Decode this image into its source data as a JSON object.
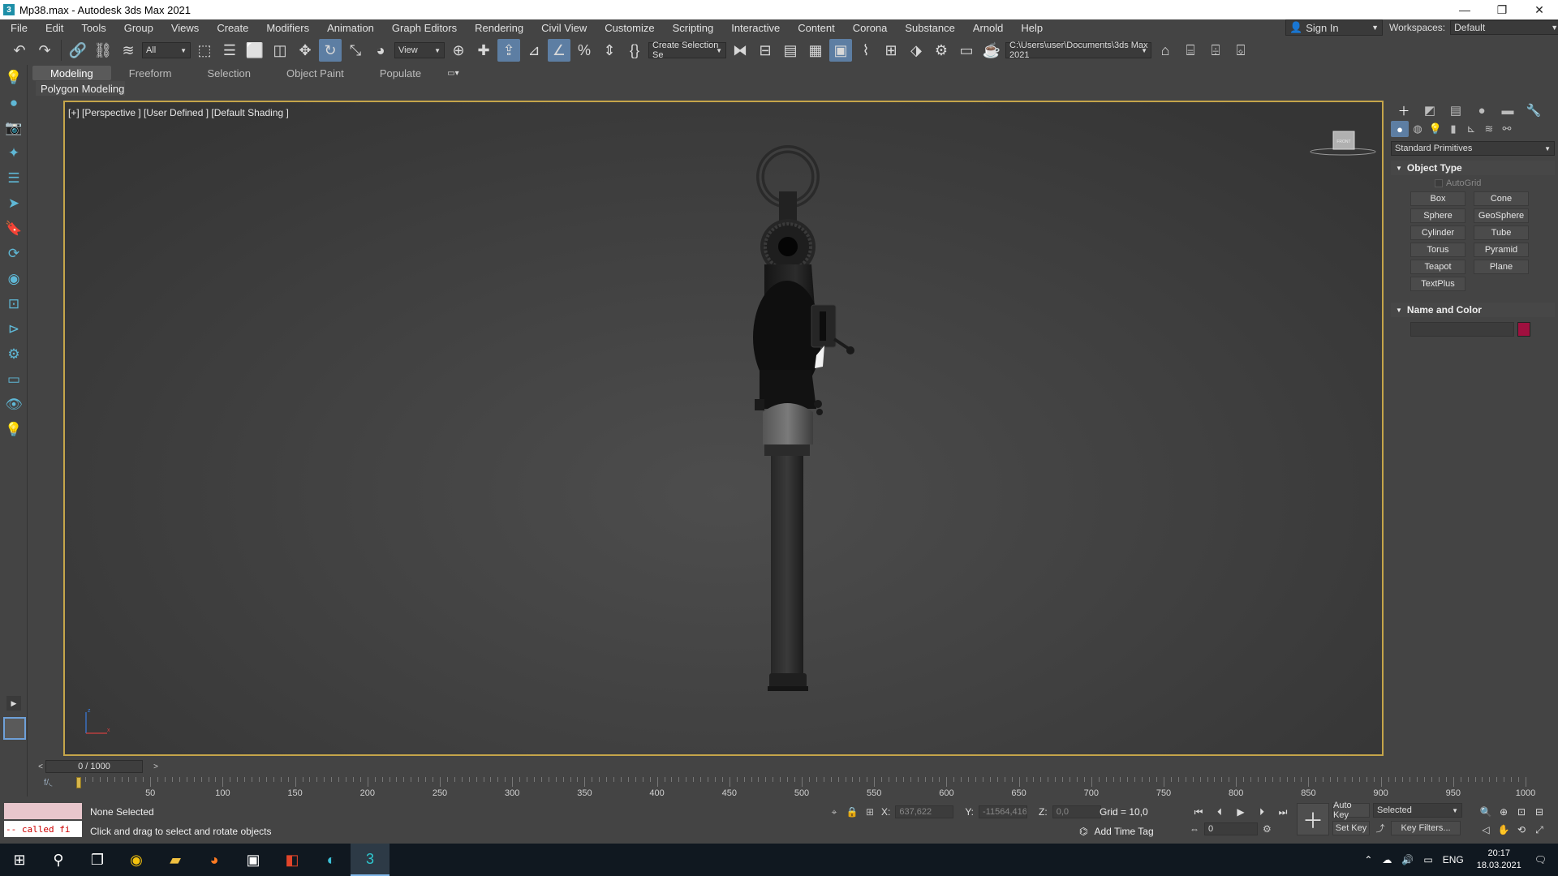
{
  "window": {
    "title": "Mp38.max - Autodesk 3ds Max 2021",
    "app_icon": "3",
    "minimize_icon": "—",
    "maximize_icon": "❐",
    "close_icon": "✕"
  },
  "menu": {
    "items": [
      "File",
      "Edit",
      "Tools",
      "Group",
      "Views",
      "Create",
      "Modifiers",
      "Animation",
      "Graph Editors",
      "Rendering",
      "Civil View",
      "Customize",
      "Scripting",
      "Interactive",
      "Content",
      "Corona",
      "Substance",
      "Arnold",
      "Help"
    ],
    "sign_in": "Sign In",
    "workspaces_label": "Workspaces:",
    "workspaces_value": "Default"
  },
  "toolbar": {
    "selection_filter": "All",
    "reference_coord": "View",
    "named_selection": "Create Selection Se",
    "project_path": "C:\\Users\\user\\Documents\\3ds Max 2021"
  },
  "ribbon": {
    "tabs": [
      "Modeling",
      "Freeform",
      "Selection",
      "Object Paint",
      "Populate"
    ],
    "active_tab": "Modeling",
    "panel_label": "Polygon Modeling"
  },
  "viewport": {
    "label": "[+] [Perspective ] [User Defined ] [Default Shading ]",
    "viewcube_label": "FRONT",
    "axis_z": "z",
    "axis_x": "x"
  },
  "command_panel": {
    "category": "Standard Primitives",
    "object_type_title": "Object Type",
    "autogrid_label": "AutoGrid",
    "buttons": [
      "Box",
      "Cone",
      "Sphere",
      "GeoSphere",
      "Cylinder",
      "Tube",
      "Torus",
      "Pyramid",
      "Teapot",
      "Plane",
      "TextPlus"
    ],
    "name_color_title": "Name and Color",
    "object_color": "#a0103f"
  },
  "timeline": {
    "frame_display": "0 / 1000",
    "prev": "<",
    "next": ">",
    "ticks": [
      0,
      50,
      100,
      150,
      200,
      250,
      300,
      350,
      400,
      450,
      500,
      550,
      600,
      650,
      700,
      750,
      800,
      850,
      900,
      950,
      1000
    ],
    "tick_labels": [
      "50",
      "100",
      "150",
      "200",
      "250",
      "300",
      "350",
      "400",
      "450",
      "500",
      "550",
      "600",
      "650",
      "700",
      "750",
      "800",
      "850",
      "900",
      "950",
      "1000"
    ],
    "current_frame": 0,
    "total_frames": 1000
  },
  "status": {
    "maxscript_output": "-- called fi",
    "selection_status": "None Selected",
    "prompt": "Click and drag to select and rotate objects",
    "x_label": "X:",
    "x_value": "637,622",
    "y_label": "Y:",
    "y_value": "-11564,416",
    "z_label": "Z:",
    "z_value": "0,0",
    "grid": "Grid = 10,0",
    "add_time_tag": "Add Time Tag",
    "frame_field": "0",
    "auto_key": "Auto Key",
    "set_key": "Set Key",
    "key_mode": "Selected",
    "key_filters": "Key Filters..."
  },
  "taskbar": {
    "language": "ENG",
    "time": "20:17",
    "date": "18.03.2021"
  }
}
